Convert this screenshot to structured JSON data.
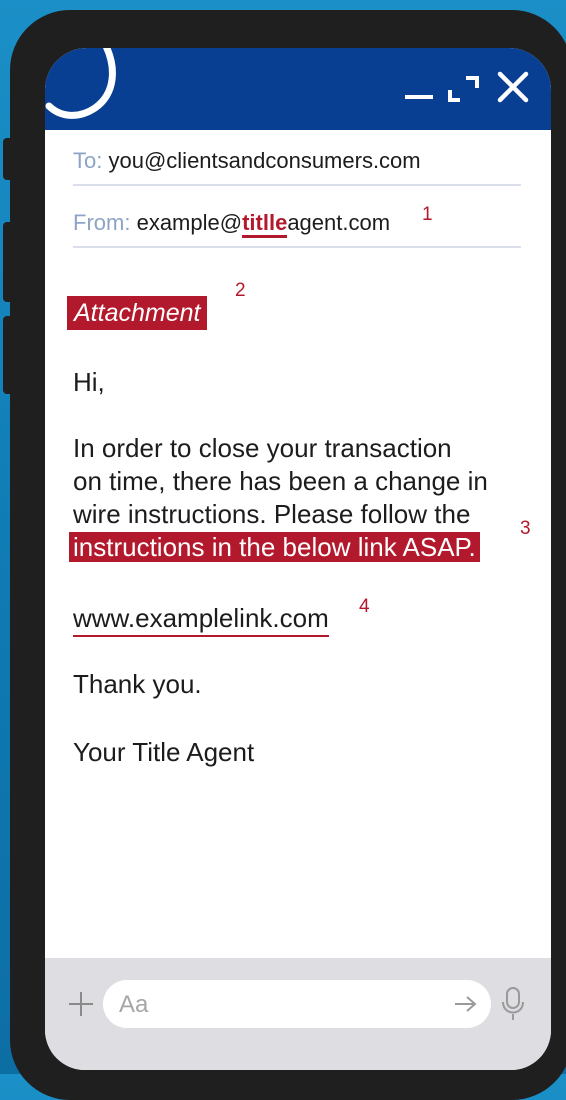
{
  "window_controls": {
    "minimize": "minimize",
    "maximize": "maximize",
    "close": "close"
  },
  "email": {
    "to_label": "To:",
    "to_value": "you@clientsandconsumers.com",
    "from_label": "From:",
    "from_prefix": "example@",
    "from_highlight": "titlle",
    "from_suffix": "agent.com",
    "attachment_label": "Attachment",
    "greeting": "Hi,",
    "body_line1": "In order to close your transaction",
    "body_line2": "on time, there has been a change in",
    "body_line3": "wire instructions. Please follow the",
    "body_line4_highlight": "instructions in the below link ASAP.",
    "link_text": "www.examplelink.com",
    "closing": "Thank you.",
    "signature": "Your Title Agent"
  },
  "markers": [
    "1",
    "2",
    "3",
    "4"
  ],
  "composer": {
    "placeholder": "Aa"
  },
  "colors": {
    "header": "#093f93",
    "highlight": "#b3192c",
    "background": "#1b8fc7"
  },
  "icons": [
    "hook-icon",
    "minimize-icon",
    "maximize-icon",
    "close-icon",
    "plus-icon",
    "send-arrow-icon",
    "microphone-icon"
  ]
}
